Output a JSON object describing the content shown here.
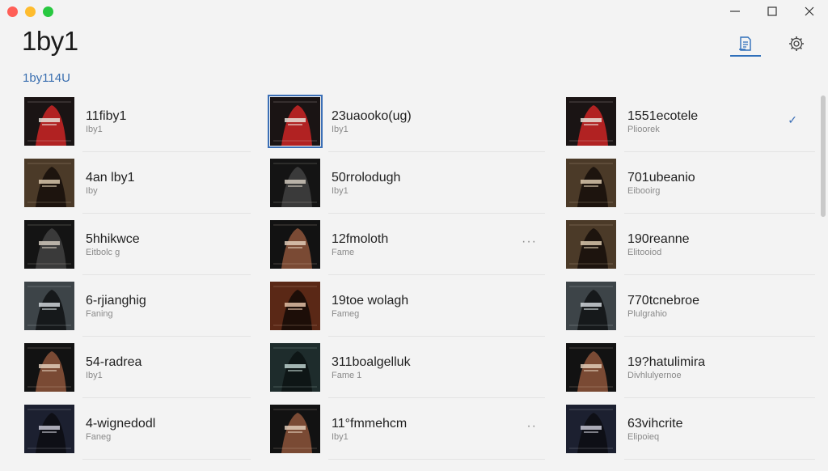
{
  "window": {
    "app_title": "1by1",
    "subtitle": "1by114U"
  },
  "columns": [
    [
      {
        "title": "11fiby1",
        "subtitle": "Iby1",
        "art": "red",
        "selected": false
      },
      {
        "title": "4an lby1",
        "subtitle": "Iby",
        "art": "tan",
        "selected": false
      },
      {
        "title": "5hhikwce",
        "subtitle": "Eitbolc g",
        "art": "dark",
        "selected": false
      },
      {
        "title": "6-rjianghig",
        "subtitle": "Faning",
        "art": "grey",
        "selected": false
      },
      {
        "title": "54-radrea",
        "subtitle": "Iby1",
        "art": "hand",
        "selected": false
      },
      {
        "title": "4-wignedodl",
        "subtitle": "Faneg",
        "art": "night",
        "selected": false
      }
    ],
    [
      {
        "title": "23uaooko(ug)",
        "subtitle": "Iby1",
        "art": "red",
        "selected": true
      },
      {
        "title": "50rrolodugh",
        "subtitle": "Iby1",
        "art": "dark",
        "selected": false
      },
      {
        "title": "12fmoloth",
        "subtitle": "Fame",
        "art": "hand",
        "selected": false,
        "more": "···"
      },
      {
        "title": "19toe wolagh",
        "subtitle": "Fameg",
        "art": "rust",
        "selected": false
      },
      {
        "title": "311boalgelluk",
        "subtitle": "Fame 1",
        "art": "teal",
        "selected": false
      },
      {
        "title": "11°fmmehcm",
        "subtitle": "Iby1",
        "art": "hand",
        "selected": false,
        "more": "··"
      }
    ],
    [
      {
        "title": "1551ecotele",
        "subtitle": "Plioorek",
        "art": "red",
        "selected": false,
        "check": "✓"
      },
      {
        "title": "701ubeanio",
        "subtitle": "Eibooirg",
        "art": "tan",
        "selected": false
      },
      {
        "title": "190reanne",
        "subtitle": "Elitooiod",
        "art": "tan",
        "selected": false
      },
      {
        "title": "770tcnebroe",
        "subtitle": "Plulgrahio",
        "art": "grey",
        "selected": false
      },
      {
        "title": "19?hatulimira",
        "subtitle": "Divhlulyernoe",
        "art": "hand",
        "selected": false
      },
      {
        "title": "63vihcrite",
        "subtitle": "Elipoieq",
        "art": "night",
        "selected": false
      }
    ]
  ],
  "icons": {
    "minimize": "minimize-icon",
    "maximize": "maximize-icon",
    "close": "close-icon",
    "library": "library-icon",
    "settings": "gear-icon"
  },
  "colors": {
    "accent": "#2f6fba",
    "background": "#f3f3f3"
  }
}
